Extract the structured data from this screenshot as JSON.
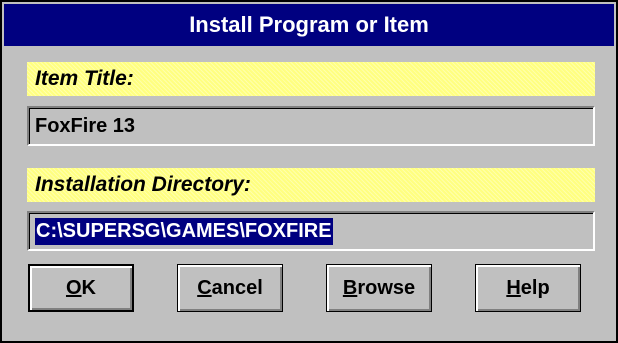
{
  "window": {
    "title": "Install Program or Item"
  },
  "fields": {
    "item_title": {
      "label": "Item Title:",
      "value": "FoxFire 13"
    },
    "install_dir": {
      "label": "Installation Directory:",
      "value": "C:\\SUPERSG\\GAMES\\FOXFIRE"
    }
  },
  "buttons": {
    "ok": {
      "mnemonic": "O",
      "rest": "K"
    },
    "cancel": {
      "mnemonic": "C",
      "rest": "ancel"
    },
    "browse": {
      "mnemonic": "B",
      "rest": "rowse"
    },
    "help": {
      "mnemonic": "H",
      "rest": "elp"
    }
  },
  "colors": {
    "title_bar": "#000080",
    "label_background": "#ffff80",
    "dialog_background": "#c0c0c0",
    "selection": "#000080"
  }
}
